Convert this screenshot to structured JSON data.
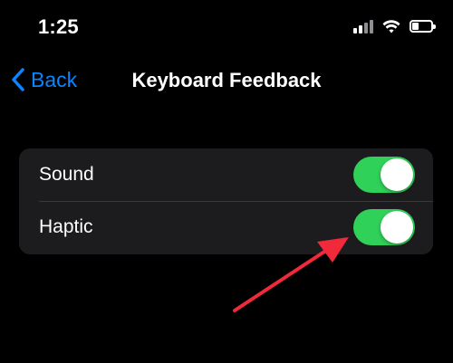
{
  "status_bar": {
    "time": "1:25",
    "signal_icon": "cellular-signal-icon",
    "wifi_icon": "wifi-icon",
    "battery_icon": "battery-icon",
    "battery_level": 0.3
  },
  "nav": {
    "back_icon": "chevron-left-icon",
    "back_label": "Back",
    "title": "Keyboard Feedback"
  },
  "settings": {
    "rows": [
      {
        "label": "Sound",
        "toggle_on": true
      },
      {
        "label": "Haptic",
        "toggle_on": true
      }
    ]
  },
  "annotation": {
    "icon": "red-arrow-icon",
    "points_to": "Haptic toggle"
  },
  "colors": {
    "background": "#000000",
    "group_background": "#1c1c1e",
    "accent_blue": "#0a84ff",
    "toggle_on_green": "#30d158",
    "annotation_red": "#f0293b"
  }
}
